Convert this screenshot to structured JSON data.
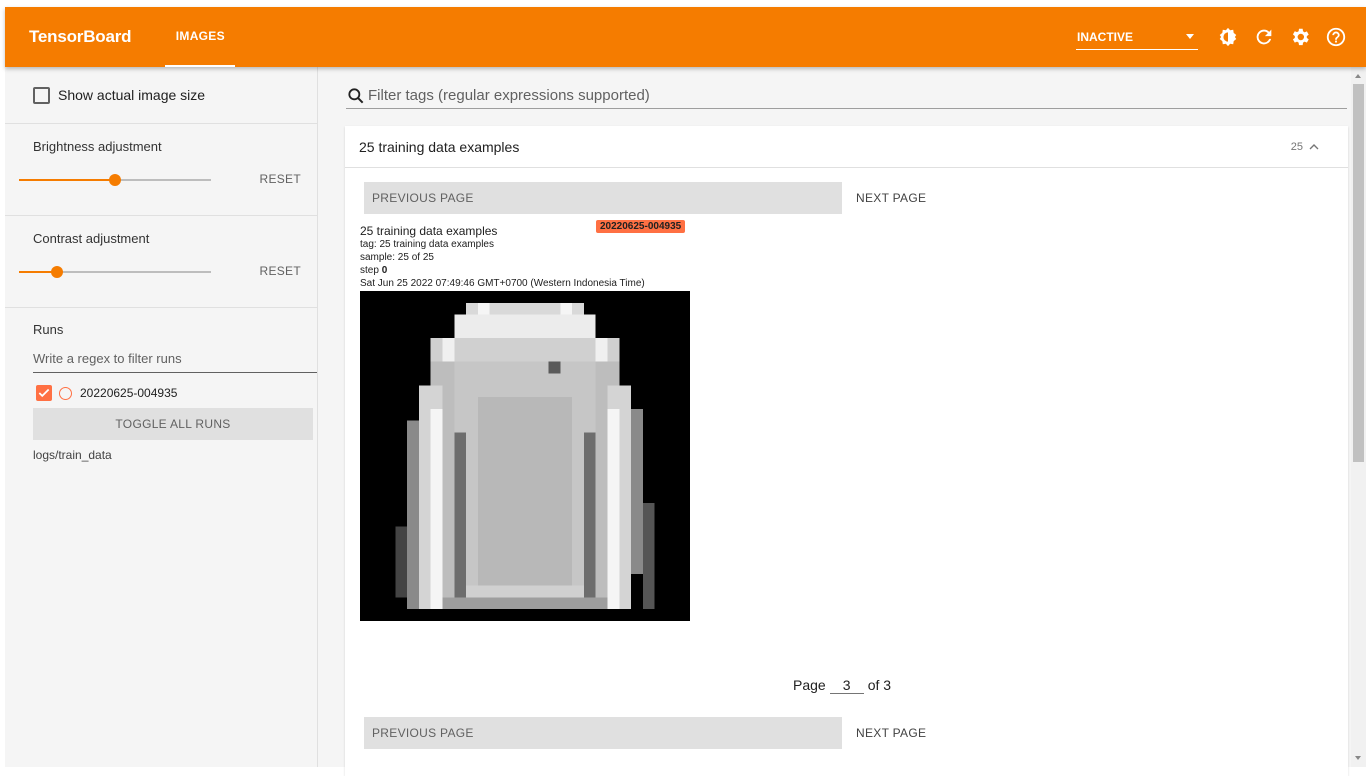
{
  "header": {
    "brand": "TensorBoard",
    "tab_images": "IMAGES",
    "status": "INACTIVE",
    "accent_color": "#f57c00"
  },
  "sidebar": {
    "show_actual_size_label": "Show actual image size",
    "brightness": {
      "label": "Brightness adjustment",
      "reset": "RESET",
      "level": 0.5
    },
    "contrast": {
      "label": "Contrast adjustment",
      "reset": "RESET",
      "level": 0.2
    },
    "runs": {
      "title": "Runs",
      "filter_placeholder": "Write a regex to filter runs",
      "items": [
        {
          "name": "20220625-004935",
          "checked": true,
          "color": "#ff7043"
        }
      ],
      "toggle_all": "TOGGLE ALL RUNS",
      "logdir": "logs/train_data"
    }
  },
  "main": {
    "filter_placeholder": "Filter tags (regular expressions supported)",
    "card": {
      "title": "25 training data examples",
      "count": "25",
      "prev_page": "PREVIOUS PAGE",
      "next_page": "NEXT PAGE",
      "image": {
        "title": "25 training data examples",
        "tag_line": "tag: 25 training data examples",
        "sample_line": "sample: 25 of 25",
        "step_label": "step",
        "step_value": "0",
        "date": "Sat Jun 25 2022 07:49:46 GMT+0700 (Western Indonesia Time)",
        "run_badge": "20220625-004935"
      },
      "page_label": "Page",
      "page_current": "3",
      "page_total_label": "of 3"
    }
  }
}
